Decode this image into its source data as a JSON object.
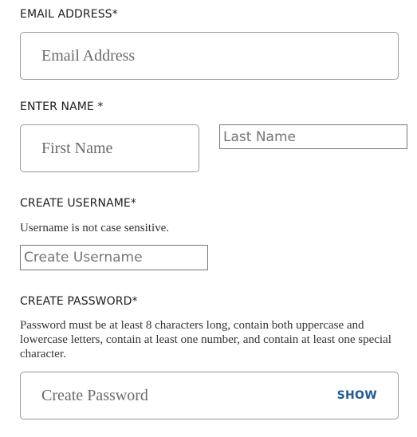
{
  "email": {
    "label": "EMAIL ADDRESS*",
    "placeholder": "Email Address",
    "value": ""
  },
  "name": {
    "label": "ENTER NAME *",
    "first_placeholder": "First Name",
    "last_placeholder": "Last Name"
  },
  "username": {
    "label": "CREATE USERNAME*",
    "hint": "Username is not case sensitive.",
    "placeholder": "Create Username"
  },
  "password": {
    "label": "CREATE PASSWORD*",
    "hint": "Password must be at least 8 characters long, contain both uppercase and lowercase letters, contain at least one number, and contain at least one special character.",
    "placeholder": "Create Password",
    "show_label": "SHOW"
  },
  "colors": {
    "show_link": "#1f5a96",
    "field_border": "#9a9a9a"
  }
}
